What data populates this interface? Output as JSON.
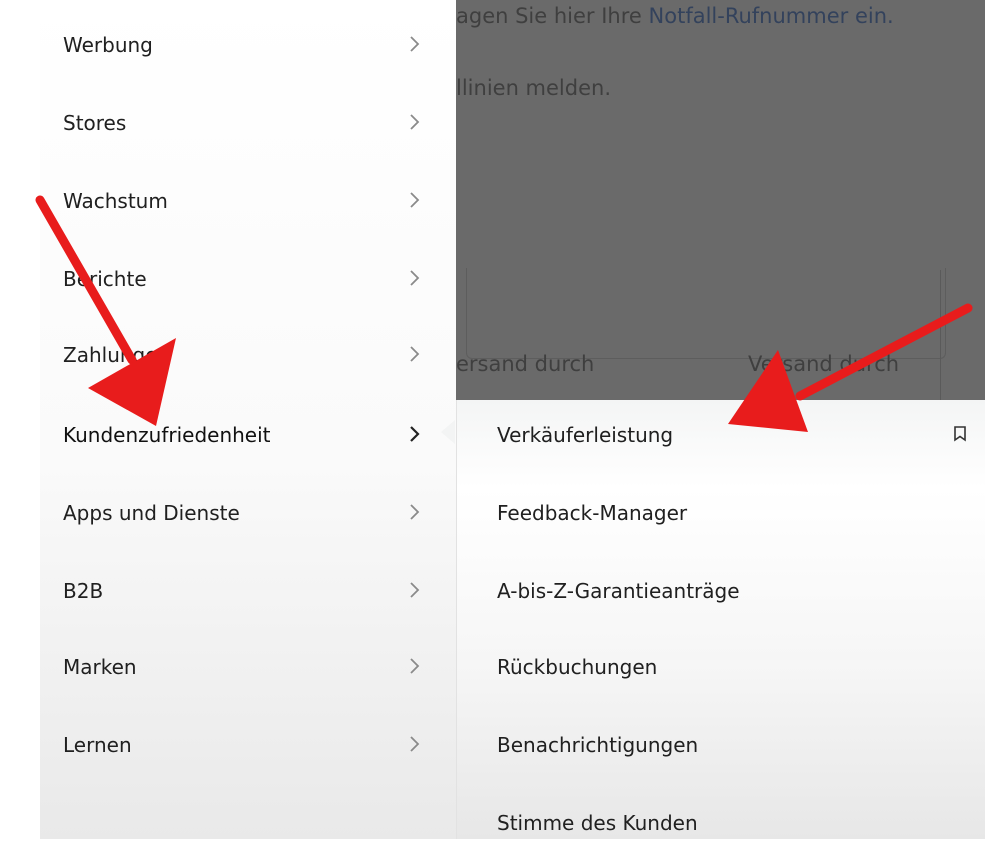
{
  "background": {
    "text_line1": "agen Sie hier Ihre",
    "text_line1_link": "Notfall-Rufnummer ein.",
    "text_line2": "llinien melden.",
    "col1": "ersand durch",
    "col2": "Versand durch"
  },
  "main_menu": {
    "items": [
      {
        "label": "Werbung"
      },
      {
        "label": "Stores"
      },
      {
        "label": "Wachstum"
      },
      {
        "label": "Berichte"
      },
      {
        "label": "Zahlungen"
      },
      {
        "label": "Kundenzufriedenheit"
      },
      {
        "label": "Apps und Dienste"
      },
      {
        "label": "B2B"
      },
      {
        "label": "Marken"
      },
      {
        "label": "Lernen"
      }
    ],
    "active_item": "Kundenzufriedenheit"
  },
  "sub_menu": {
    "items": [
      {
        "label": "Verkäuferleistung"
      },
      {
        "label": "Feedback-Manager"
      },
      {
        "label": "A-bis-Z-Garantieanträge"
      },
      {
        "label": "Rückbuchungen"
      },
      {
        "label": "Benachrichtigungen"
      },
      {
        "label": "Stimme des Kunden"
      }
    ]
  },
  "icons": {
    "chevron": "chevron-right-icon",
    "bookmark": "bookmark-icon"
  },
  "colors": {
    "annotation_arrow": "#e81c1c",
    "overlay": "#6a6a6a"
  }
}
